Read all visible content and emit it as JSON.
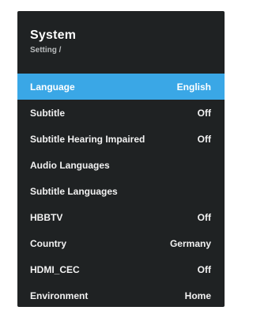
{
  "header": {
    "title": "System",
    "breadcrumb": "Setting /"
  },
  "menu": {
    "selected_index": 0,
    "items": [
      {
        "label": "Language",
        "value": "English"
      },
      {
        "label": "Subtitle",
        "value": "Off"
      },
      {
        "label": "Subtitle Hearing Impaired",
        "value": "Off"
      },
      {
        "label": "Audio Languages",
        "value": ""
      },
      {
        "label": "Subtitle Languages",
        "value": ""
      },
      {
        "label": "HBBTV",
        "value": "Off"
      },
      {
        "label": "Country",
        "value": "Germany"
      },
      {
        "label": "HDMI_CEC",
        "value": "Off"
      },
      {
        "label": "Environment",
        "value": "Home"
      }
    ]
  },
  "colors": {
    "panel_background": "#1f2223",
    "highlight": "#3aa7e6",
    "text": "#f2f2f2",
    "breadcrumb_text": "#b9bcbd"
  }
}
